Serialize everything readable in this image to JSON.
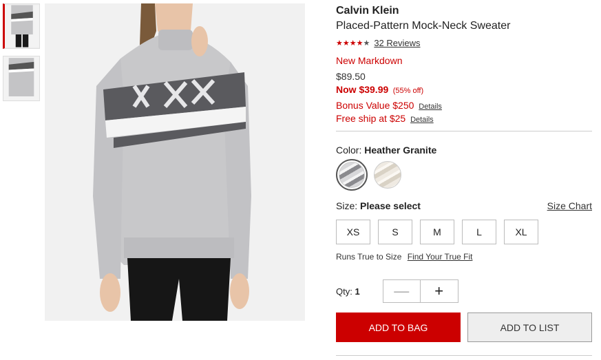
{
  "thumbnails": [
    {
      "alt": "front view",
      "active": true
    },
    {
      "alt": "back view",
      "active": false
    }
  ],
  "product": {
    "brand": "Calvin Klein",
    "title": "Placed-Pattern Mock-Neck Sweater",
    "rating_stars": "★★★★",
    "rating_empty_star": "★",
    "rating_value": 4,
    "reviews_label": "32 Reviews",
    "markdown_label": "New Markdown",
    "original_price": "$89.50",
    "now_price": "Now $39.99",
    "percent_off": "(55% off)",
    "bonus_text": "Bonus Value $250",
    "bonus_details": "Details",
    "free_ship_text": "Free ship at $25",
    "free_ship_details": "Details"
  },
  "color": {
    "label": "Color: ",
    "selected": "Heather Granite",
    "swatches": [
      {
        "name": "Heather Granite",
        "color": "#b5b5b8"
      },
      {
        "name": "Oatmeal",
        "color": "#e4ded3"
      }
    ]
  },
  "size": {
    "label": "Size: ",
    "selected": "Please select",
    "chart_label": "Size Chart",
    "options": [
      "XS",
      "S",
      "M",
      "L",
      "XL"
    ],
    "fit_text": "Runs True to Size",
    "fit_link": "Find Your True Fit"
  },
  "qty": {
    "label": "Qty: ",
    "value": "1",
    "minus": "—",
    "plus": "+"
  },
  "actions": {
    "add_to_bag": "ADD TO BAG",
    "add_to_list": "ADD TO LIST"
  },
  "colors": {
    "accent": "#cc0000"
  }
}
